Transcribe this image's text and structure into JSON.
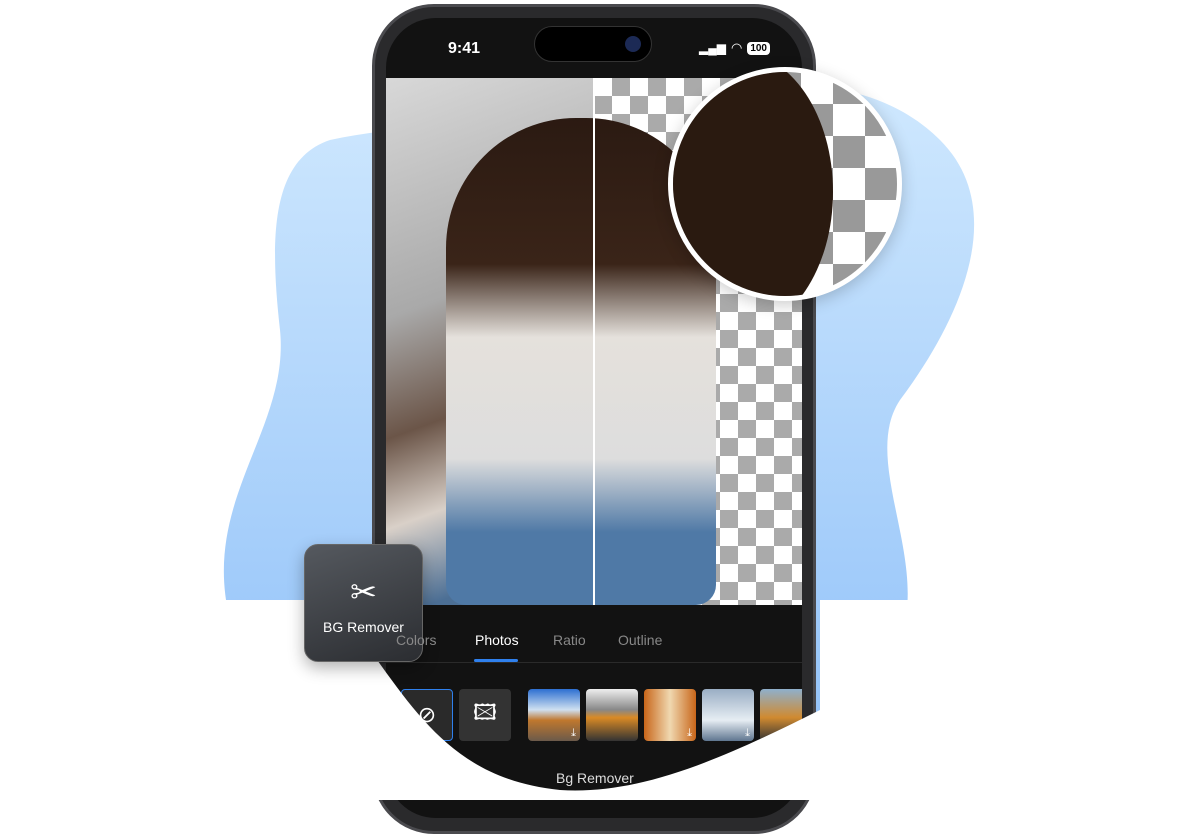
{
  "colors": {
    "accent": "#2f80ed",
    "blob": "#a9d3fb",
    "screen_bg": "#121212"
  },
  "status_bar": {
    "time": "9:41",
    "battery": "100",
    "icons": [
      "signal-icon",
      "wifi-icon",
      "battery-icon"
    ]
  },
  "tabs": [
    {
      "label": "Colors",
      "visible_text": "ors"
    },
    {
      "label": "Photos",
      "active": true
    },
    {
      "label": "Ratio"
    },
    {
      "label": "Outline"
    }
  ],
  "tools": [
    {
      "icon": "none-icon",
      "selected": true
    },
    {
      "icon": "add-image-icon"
    }
  ],
  "thumbnails": [
    {
      "name": "desert-road",
      "download": true
    },
    {
      "name": "city-street",
      "download": false
    },
    {
      "name": "autumn-trees",
      "download": true
    },
    {
      "name": "snowy-road",
      "download": true
    },
    {
      "name": "mountain-road",
      "download": false
    }
  ],
  "caption": "Bg Remover",
  "feature_card": {
    "icon": "scissors-icon",
    "label": "BG Remover"
  }
}
